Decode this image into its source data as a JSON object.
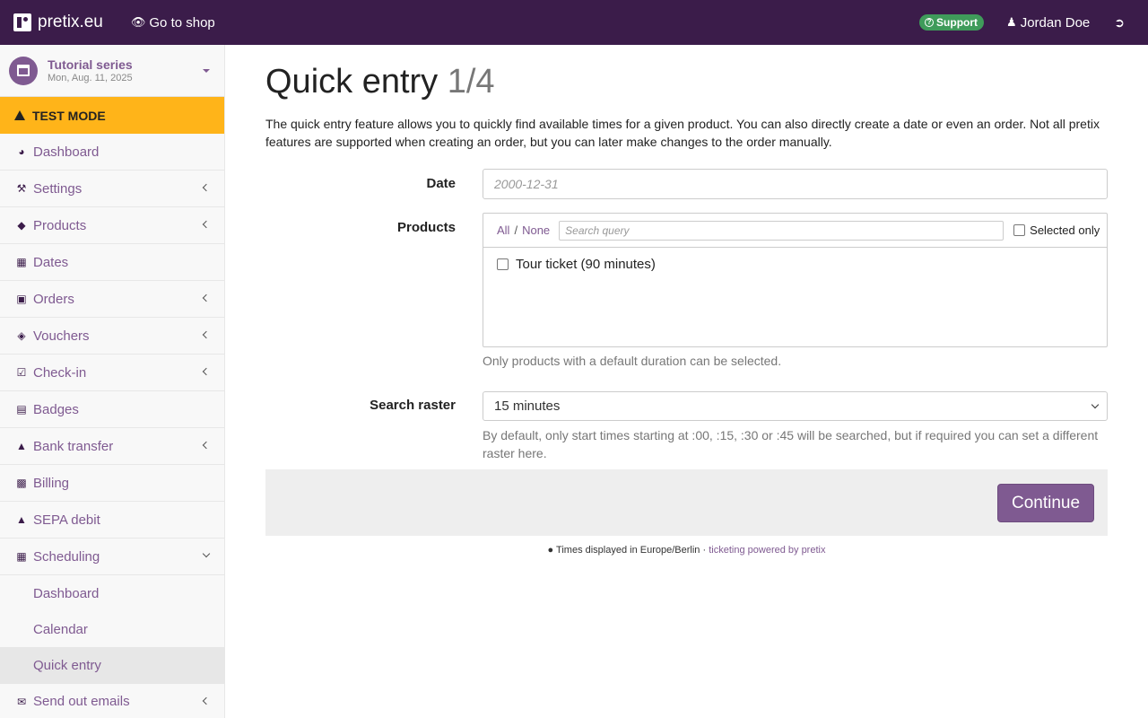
{
  "topbar": {
    "brand": "pretix.eu",
    "go_to_shop": "Go to shop",
    "support": "Support",
    "user": "Jordan Doe",
    "logout_icon": "sign-out-icon"
  },
  "event": {
    "name": "Tutorial series",
    "date": "Mon, Aug. 11, 2025"
  },
  "test_mode": "TEST MODE",
  "nav": {
    "dashboard": "Dashboard",
    "settings": "Settings",
    "products": "Products",
    "dates": "Dates",
    "orders": "Orders",
    "vouchers": "Vouchers",
    "checkin": "Check-in",
    "badges": "Badges",
    "bank_transfer": "Bank transfer",
    "billing": "Billing",
    "sepa_debit": "SEPA debit",
    "scheduling": "Scheduling",
    "scheduling_dashboard": "Dashboard",
    "scheduling_calendar": "Calendar",
    "scheduling_quick_entry": "Quick entry",
    "send_out_emails": "Send out emails"
  },
  "page": {
    "title": "Quick entry",
    "step": "1/4",
    "intro": "The quick entry feature allows you to quickly find available times for a given product. You can also directly create a date or even an order. Not all pretix features are supported when creating an order, but you can later make changes to the order manually."
  },
  "form": {
    "date_label": "Date",
    "date_placeholder": "2000-12-31",
    "products_label": "Products",
    "all": "All",
    "slash": "/",
    "none": "None",
    "search_placeholder": "Search query",
    "selected_only": "Selected only",
    "products": [
      {
        "name": "Tour ticket (90 minutes)",
        "checked": false
      }
    ],
    "products_help": "Only products with a default duration can be selected.",
    "raster_label": "Search raster",
    "raster_value": "15 minutes",
    "raster_help": "By default, only start times starting at :00, :15, :30 or :45 will be searched, but if required you can set a different raster here.",
    "continue": "Continue"
  },
  "footer": {
    "timezone": "Times displayed in Europe/Berlin",
    "dot": "·",
    "powered": "ticketing powered by pretix"
  },
  "colors": {
    "topbar": "#3b1c4a",
    "accent": "#7f5a91",
    "test_mode": "#ffb419",
    "support": "#3f9b5a"
  }
}
